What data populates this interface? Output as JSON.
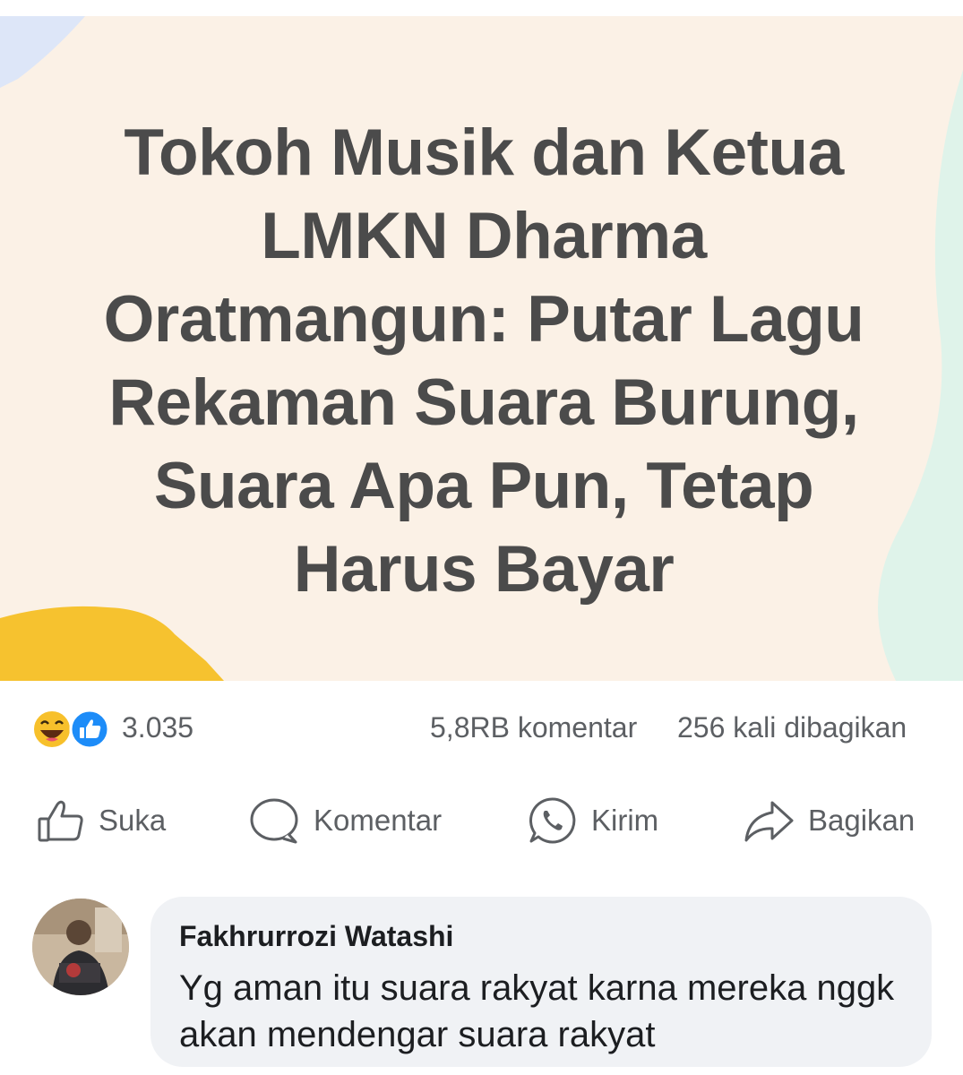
{
  "post": {
    "headline": "Tokoh Musik dan Ketua LMKN Dharma Oratmangun: Putar Lagu Rekaman Suara Burung, Suara Apa Pun, Tetap Harus Bayar",
    "background_color": "#fbf1e6",
    "accent_colors": [
      "#f6c22f",
      "#dde8f7",
      "#dff3ea"
    ]
  },
  "reactions": {
    "icons": [
      "laughing-emoji-icon",
      "like-thumb-icon"
    ],
    "count": "3.035",
    "comments": "5,8RB komentar",
    "shares": "256 kali dibagikan"
  },
  "actions": {
    "like": "Suka",
    "comment": "Komentar",
    "send": "Kirim",
    "share": "Bagikan"
  },
  "comment": {
    "author": "Fakhrurrozi Watashi",
    "text": "Yg aman itu suara rakyat karna mereka nggk akan mendengar  suara rakyat"
  }
}
